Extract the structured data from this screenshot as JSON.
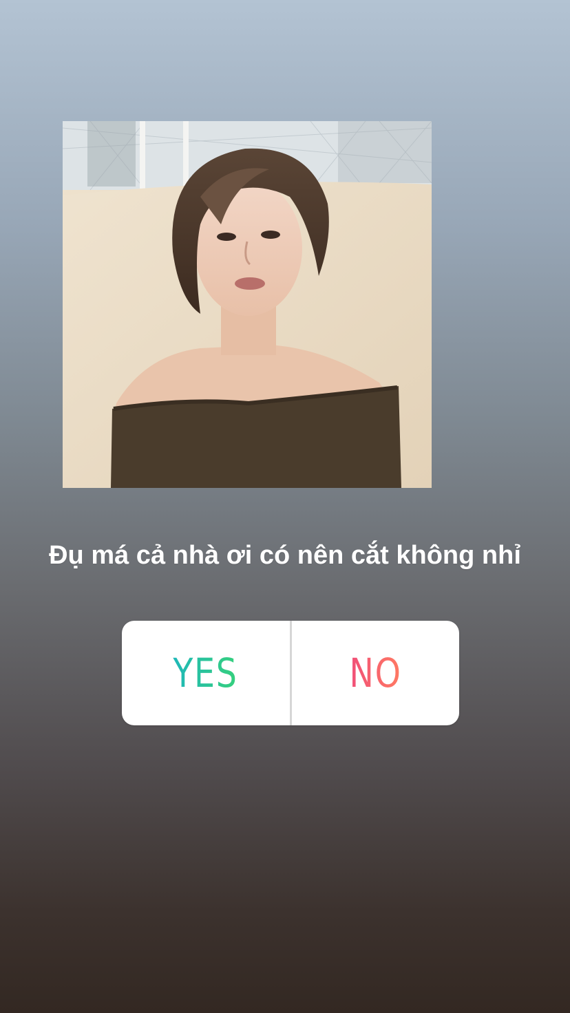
{
  "story": {
    "caption": "Đụ má cả nhà ơi có nên cắt không nhỉ"
  },
  "poll": {
    "options": [
      {
        "label": "YES"
      },
      {
        "label": "NO"
      }
    ]
  },
  "colors": {
    "yes_gradient": [
      "#1fb8b8",
      "#36d07c"
    ],
    "no_gradient": [
      "#f14f78",
      "#ff7a62"
    ],
    "poll_background": "#ffffff"
  }
}
